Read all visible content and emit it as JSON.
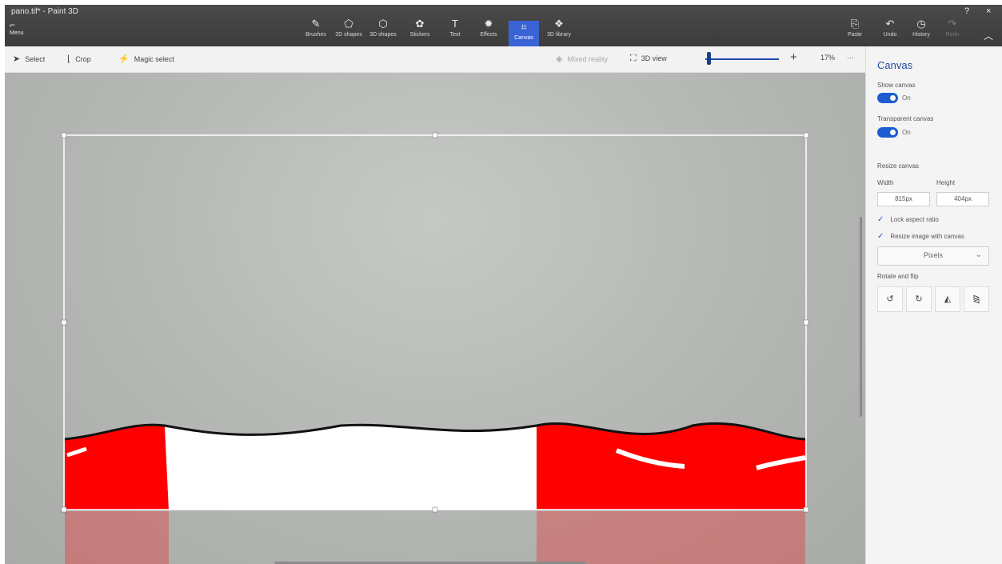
{
  "window": {
    "title": "pano.tif* - Paint 3D",
    "help": "?",
    "close": "×"
  },
  "menu": {
    "label": "Menu"
  },
  "ribbon": {
    "tools": [
      {
        "label": "Brushes",
        "icon": "brush-icon"
      },
      {
        "label": "2D shapes",
        "icon": "2d-shapes-icon"
      },
      {
        "label": "3D shapes",
        "icon": "3d-shapes-icon"
      },
      {
        "label": "Stickers",
        "icon": "stickers-icon"
      },
      {
        "label": "Text",
        "icon": "text-icon"
      },
      {
        "label": "Effects",
        "icon": "effects-icon"
      },
      {
        "label": "Canvas",
        "icon": "canvas-icon",
        "active": true
      },
      {
        "label": "3D library",
        "icon": "3d-library-icon"
      }
    ],
    "right": {
      "paste": "Paste",
      "undo": "Undo",
      "history": "History",
      "redo": "Redo"
    }
  },
  "toolbar": {
    "select": "Select",
    "crop": "Crop",
    "magic_select": "Magic select",
    "mixed_reality": "Mixed reality",
    "view_3d": "3D view",
    "zoom_percent": "17%",
    "more": "···",
    "zoom_level": 0.03
  },
  "panel": {
    "title": "Canvas",
    "show_canvas": "Show canvas",
    "show_canvas_state": "On",
    "transparent": "Transparent canvas",
    "transparent_state": "On",
    "resize": "Resize canvas",
    "width_label": "Width",
    "height_label": "Height",
    "width_value": "815px",
    "height_value": "404px",
    "lock_aspect": "Lock aspect ratio",
    "resize_image": "Resize image with canvas",
    "units": "Pixels",
    "rotate_flip": "Rotate and flip"
  },
  "colors": {
    "accent": "#1d5bd1",
    "ribbon": "#3f3f3f",
    "red": "#ff0000"
  }
}
